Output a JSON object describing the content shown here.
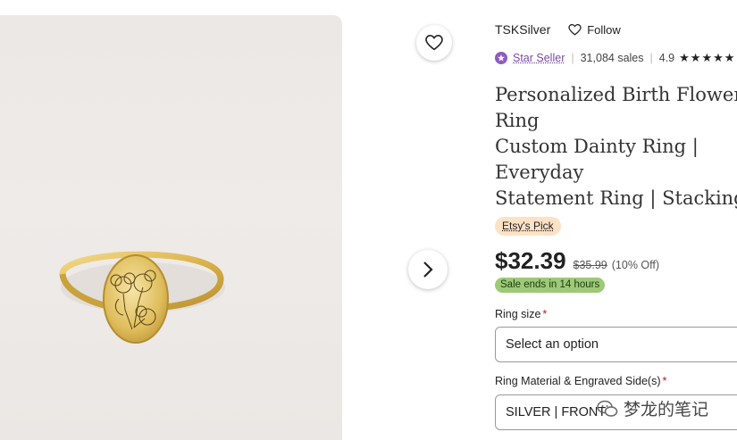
{
  "shop": {
    "name": "TSKSilver",
    "follow_label": "Follow",
    "badge_label": "Star Seller",
    "sales": "31,084 sales",
    "rating": "4.9",
    "stars": "★★★★★"
  },
  "listing": {
    "title": "Personalized Birth Flower Ring\nCustom Dainty Ring | Everyday\nStatement Ring | Stacking Ring\nMinimalist Stacking Ring | Birth\nRing",
    "pick_label": "Etsy's Pick",
    "price": "$32.39",
    "original_price": "$35.99",
    "discount": "(10% Off)",
    "sale_notice": "Sale ends in 14 hours"
  },
  "options": {
    "size_label": "Ring size",
    "size_value": "Select an option",
    "material_label": "Ring Material & Engraved Side(s)",
    "material_value": "SILVER | FRONT",
    "required_mark": "*"
  },
  "watermark": {
    "text": "梦龙的笔记"
  },
  "icons": {
    "favorite": "heart-outline-icon",
    "next": "chevron-right-icon",
    "follow": "heart-outline-icon",
    "star_seller": "star-badge-icon",
    "watermark": "wechat-icon"
  },
  "colors": {
    "star_seller": "#7c4aa8",
    "pick_bg": "#fde2c6",
    "sale_bg": "#9ec977",
    "required": "#a61a2e",
    "ring_gold": "#d9b24a"
  }
}
